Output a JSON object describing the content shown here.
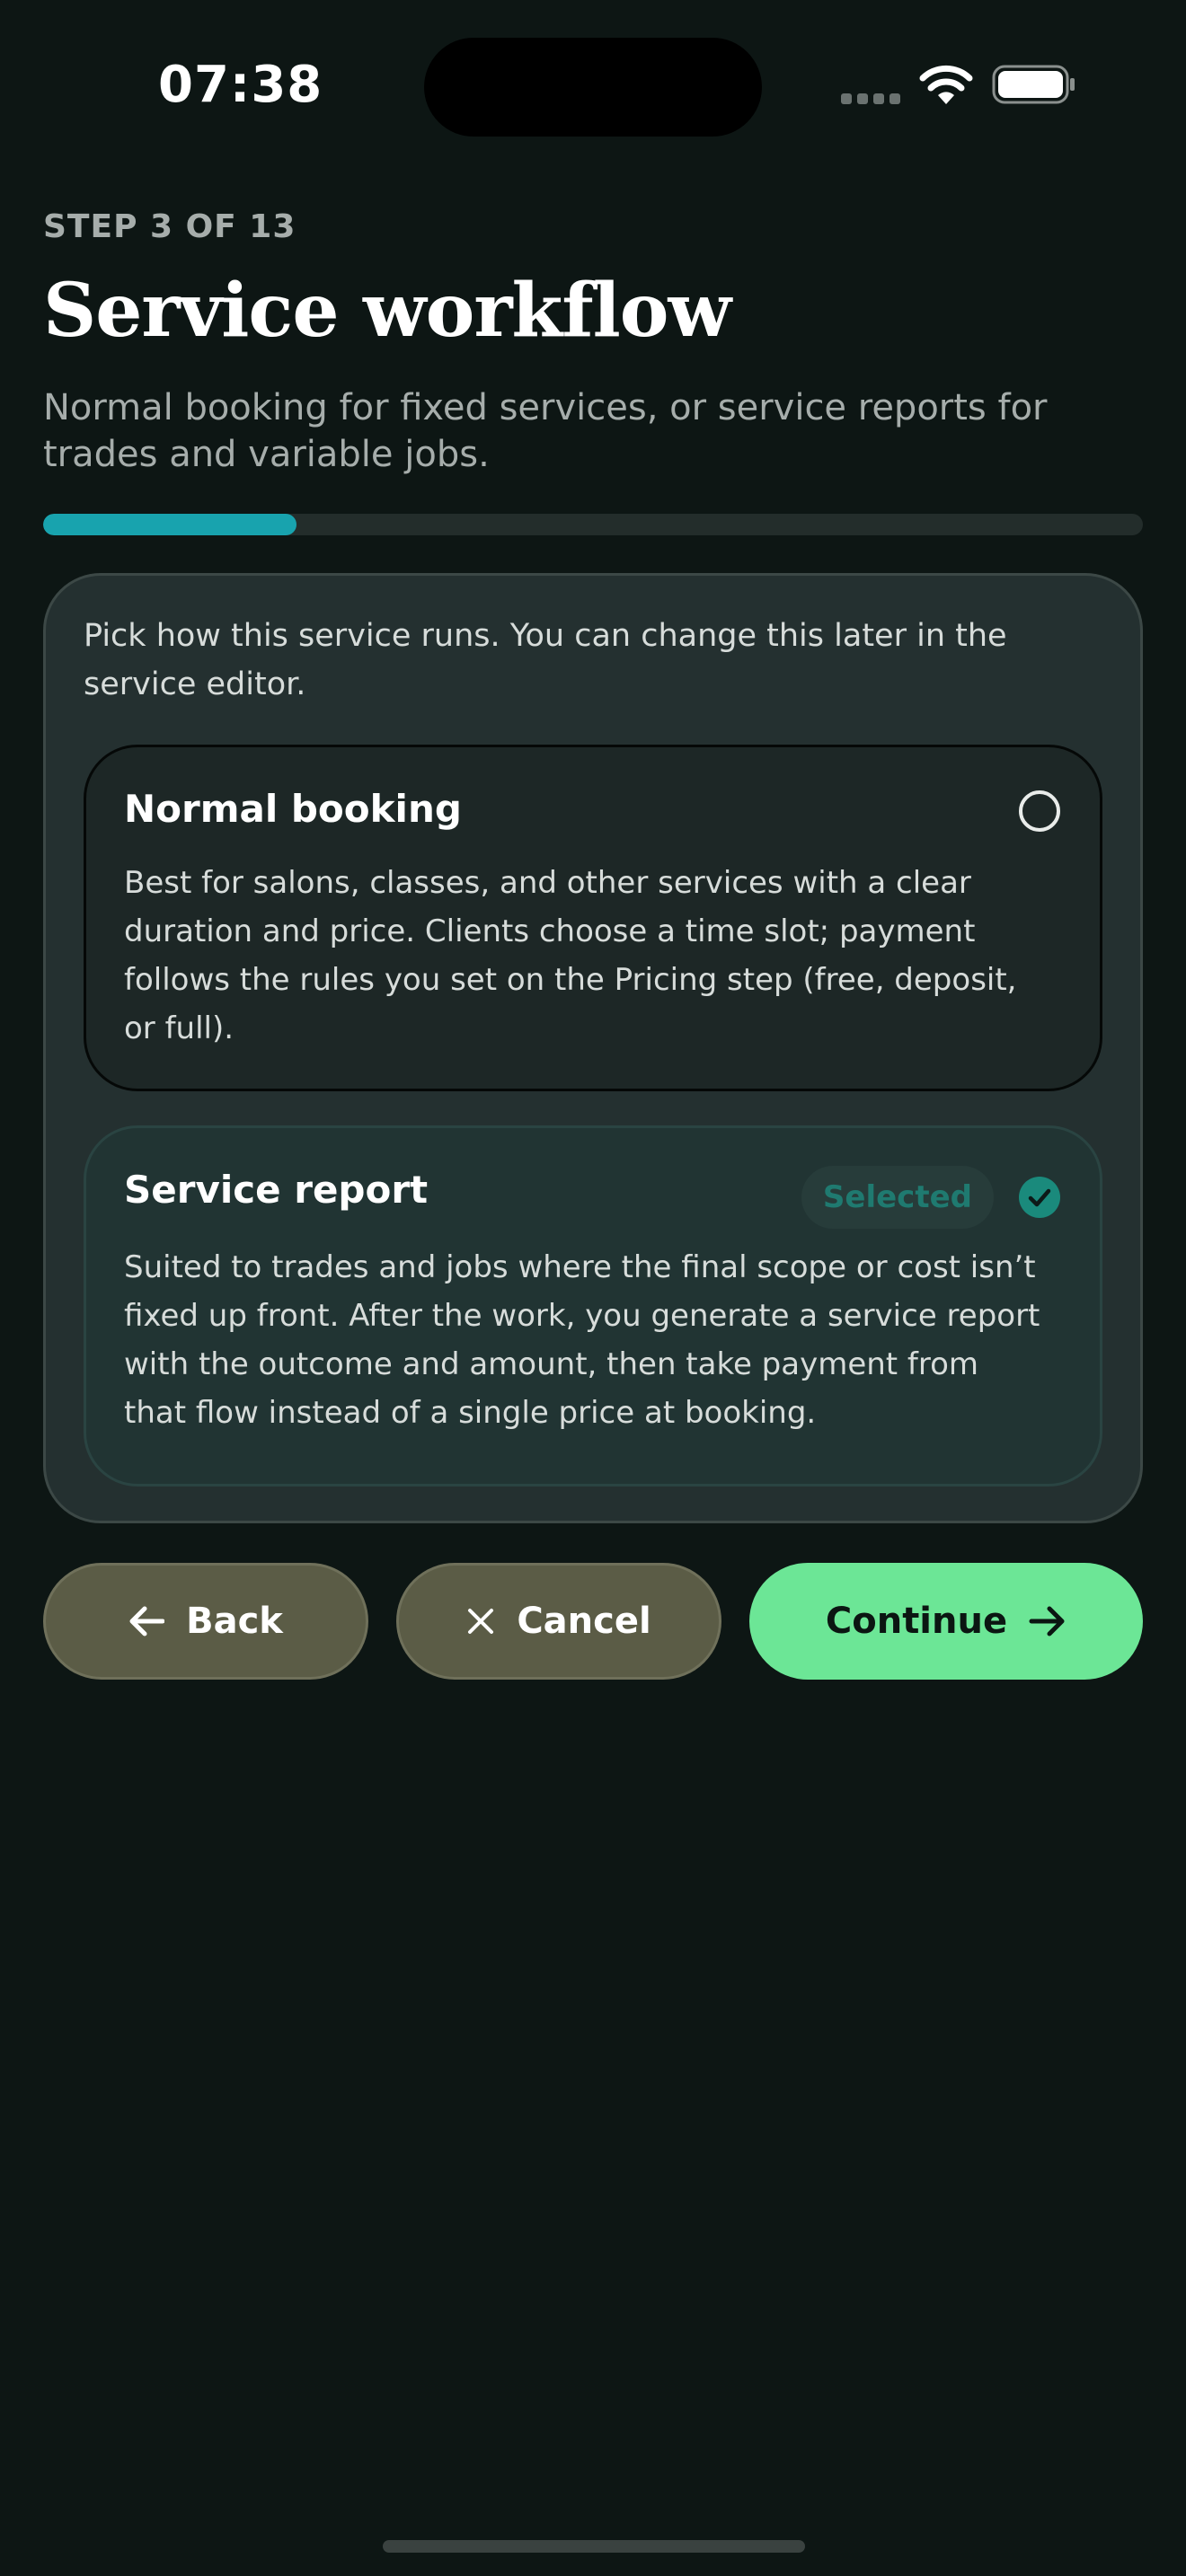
{
  "status_bar": {
    "time": "07:38"
  },
  "header": {
    "step_label": "STEP 3 OF 13",
    "title": "Service workflow",
    "subtitle": "Normal booking for fixed services, or service reports for trades and variable jobs."
  },
  "progress": {
    "current_step": 3,
    "total_steps": 13,
    "fill_fraction": 0.23,
    "color": "#18a3ae"
  },
  "card": {
    "intro": "Pick how this service runs. You can change this later in the service editor.",
    "options": [
      {
        "title": "Normal booking",
        "description": "Best for salons, classes, and other services with a clear duration and price. Clients choose a time slot; payment follows the rules you set on the Pricing step (free, deposit, or full).",
        "selected": false
      },
      {
        "title": "Service report",
        "description": "Suited to trades and jobs where the final scope or cost isn’t fixed up front. After the work, you generate a service report with the outcome and amount, then take payment from that flow instead of a single price at booking.",
        "selected": true,
        "badge": "Selected"
      }
    ]
  },
  "actions": {
    "back_label": "Back",
    "cancel_label": "Cancel",
    "continue_label": "Continue"
  },
  "colors": {
    "background": "#0d1614",
    "accent": "#6ce696",
    "selected_check": "#1a8a7c"
  }
}
